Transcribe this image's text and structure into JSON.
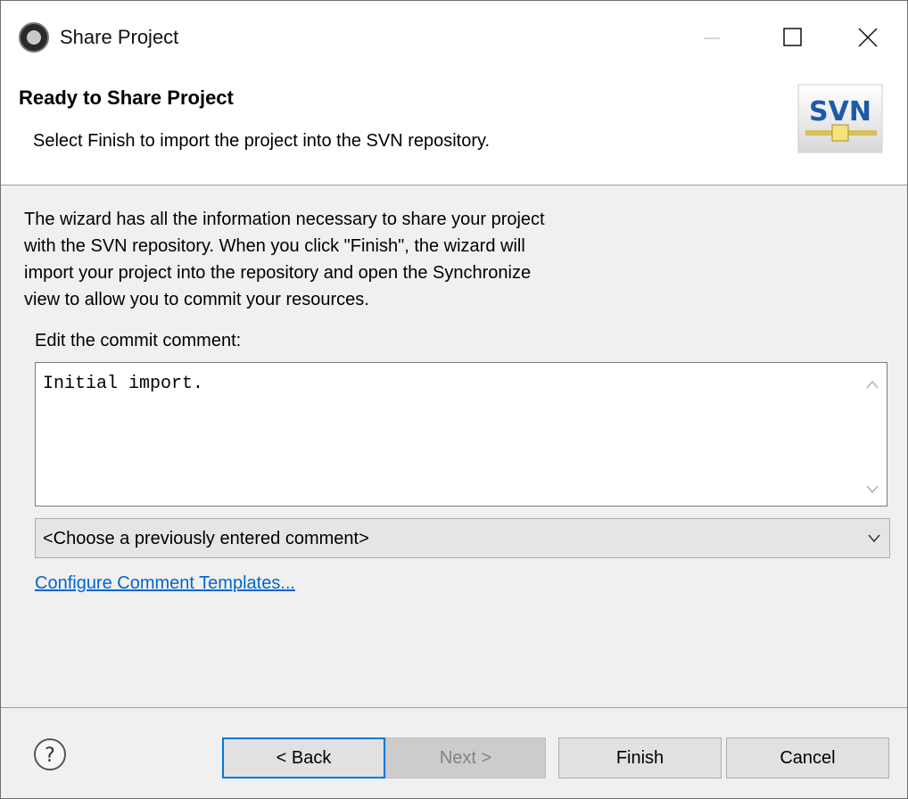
{
  "window": {
    "title": "Share Project"
  },
  "banner": {
    "title": "Ready to Share Project",
    "description": "Select Finish to import the project into the SVN repository.",
    "logo_text": "SVN"
  },
  "body": {
    "info_lines": [
      "The wizard has all the information necessary to share your project",
      "with the SVN repository. When you click \"Finish\", the wizard will",
      "import your project into the repository and open the Synchronize",
      "view to allow you to commit your resources."
    ],
    "edit_label": "Edit the commit comment:",
    "comment_value": "Initial import.",
    "combo_selected": "<Choose a previously entered comment>",
    "configure_link": "Configure Comment Templates..."
  },
  "buttons": {
    "back": "< Back",
    "next": "Next >",
    "finish": "Finish",
    "cancel": "Cancel"
  },
  "colors": {
    "link": "#0066cc",
    "default_button_border": "#0078d7",
    "svn_logo": "#1d5aa8"
  }
}
